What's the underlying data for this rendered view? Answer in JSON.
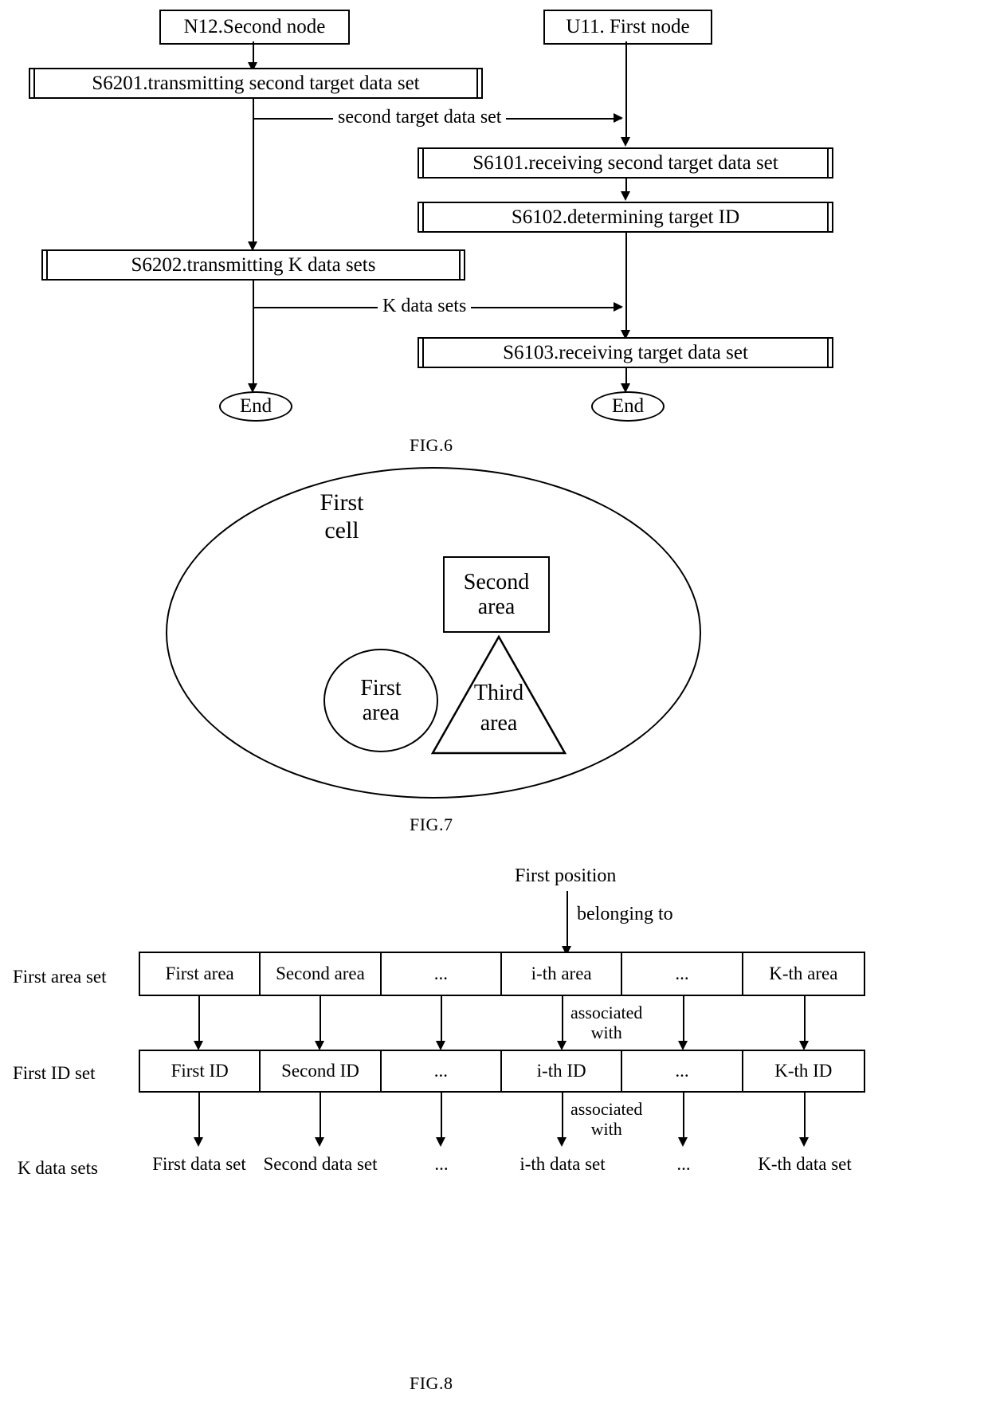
{
  "fig6": {
    "caption": "FIG.6",
    "lane_left_title": "N12.Second node",
    "lane_right_title": "U11. First node",
    "steps": {
      "s6201": "S6201.transmitting second target data set",
      "s6202": "S6202.transmitting K data sets",
      "s6101": "S6101.receiving second target data set",
      "s6102": "S6102.determining target ID",
      "s6103": "S6103.receiving target data set"
    },
    "edge_labels": {
      "second_target_data_set": "second target data set",
      "k_data_sets": "K data sets"
    },
    "end_left": "End",
    "end_right": "End"
  },
  "fig7": {
    "caption": "FIG.7",
    "cell_label_line1": "First",
    "cell_label_line2": "cell",
    "second_area_line1": "Second",
    "second_area_line2": "area",
    "first_area_line1": "First",
    "first_area_line2": "area",
    "third_area_line1": "Third",
    "third_area_line2": "area"
  },
  "fig8": {
    "caption": "FIG.8",
    "first_position": "First position",
    "belonging_to": "belonging to",
    "associated_with_line1": "associated",
    "associated_with_line2": "with",
    "rows": [
      {
        "label": "First area set",
        "boxed": true,
        "cells": [
          "First area",
          "Second area",
          "...",
          "i-th area",
          "...",
          "K-th area"
        ]
      },
      {
        "label": "First ID set",
        "boxed": true,
        "cells": [
          "First ID",
          "Second ID",
          "...",
          "i-th ID",
          "...",
          "K-th ID"
        ]
      },
      {
        "label": "K data sets",
        "boxed": false,
        "cells": [
          "First data set",
          "Second data set",
          "...",
          "i-th data set",
          "...",
          "K-th data set"
        ]
      }
    ]
  }
}
